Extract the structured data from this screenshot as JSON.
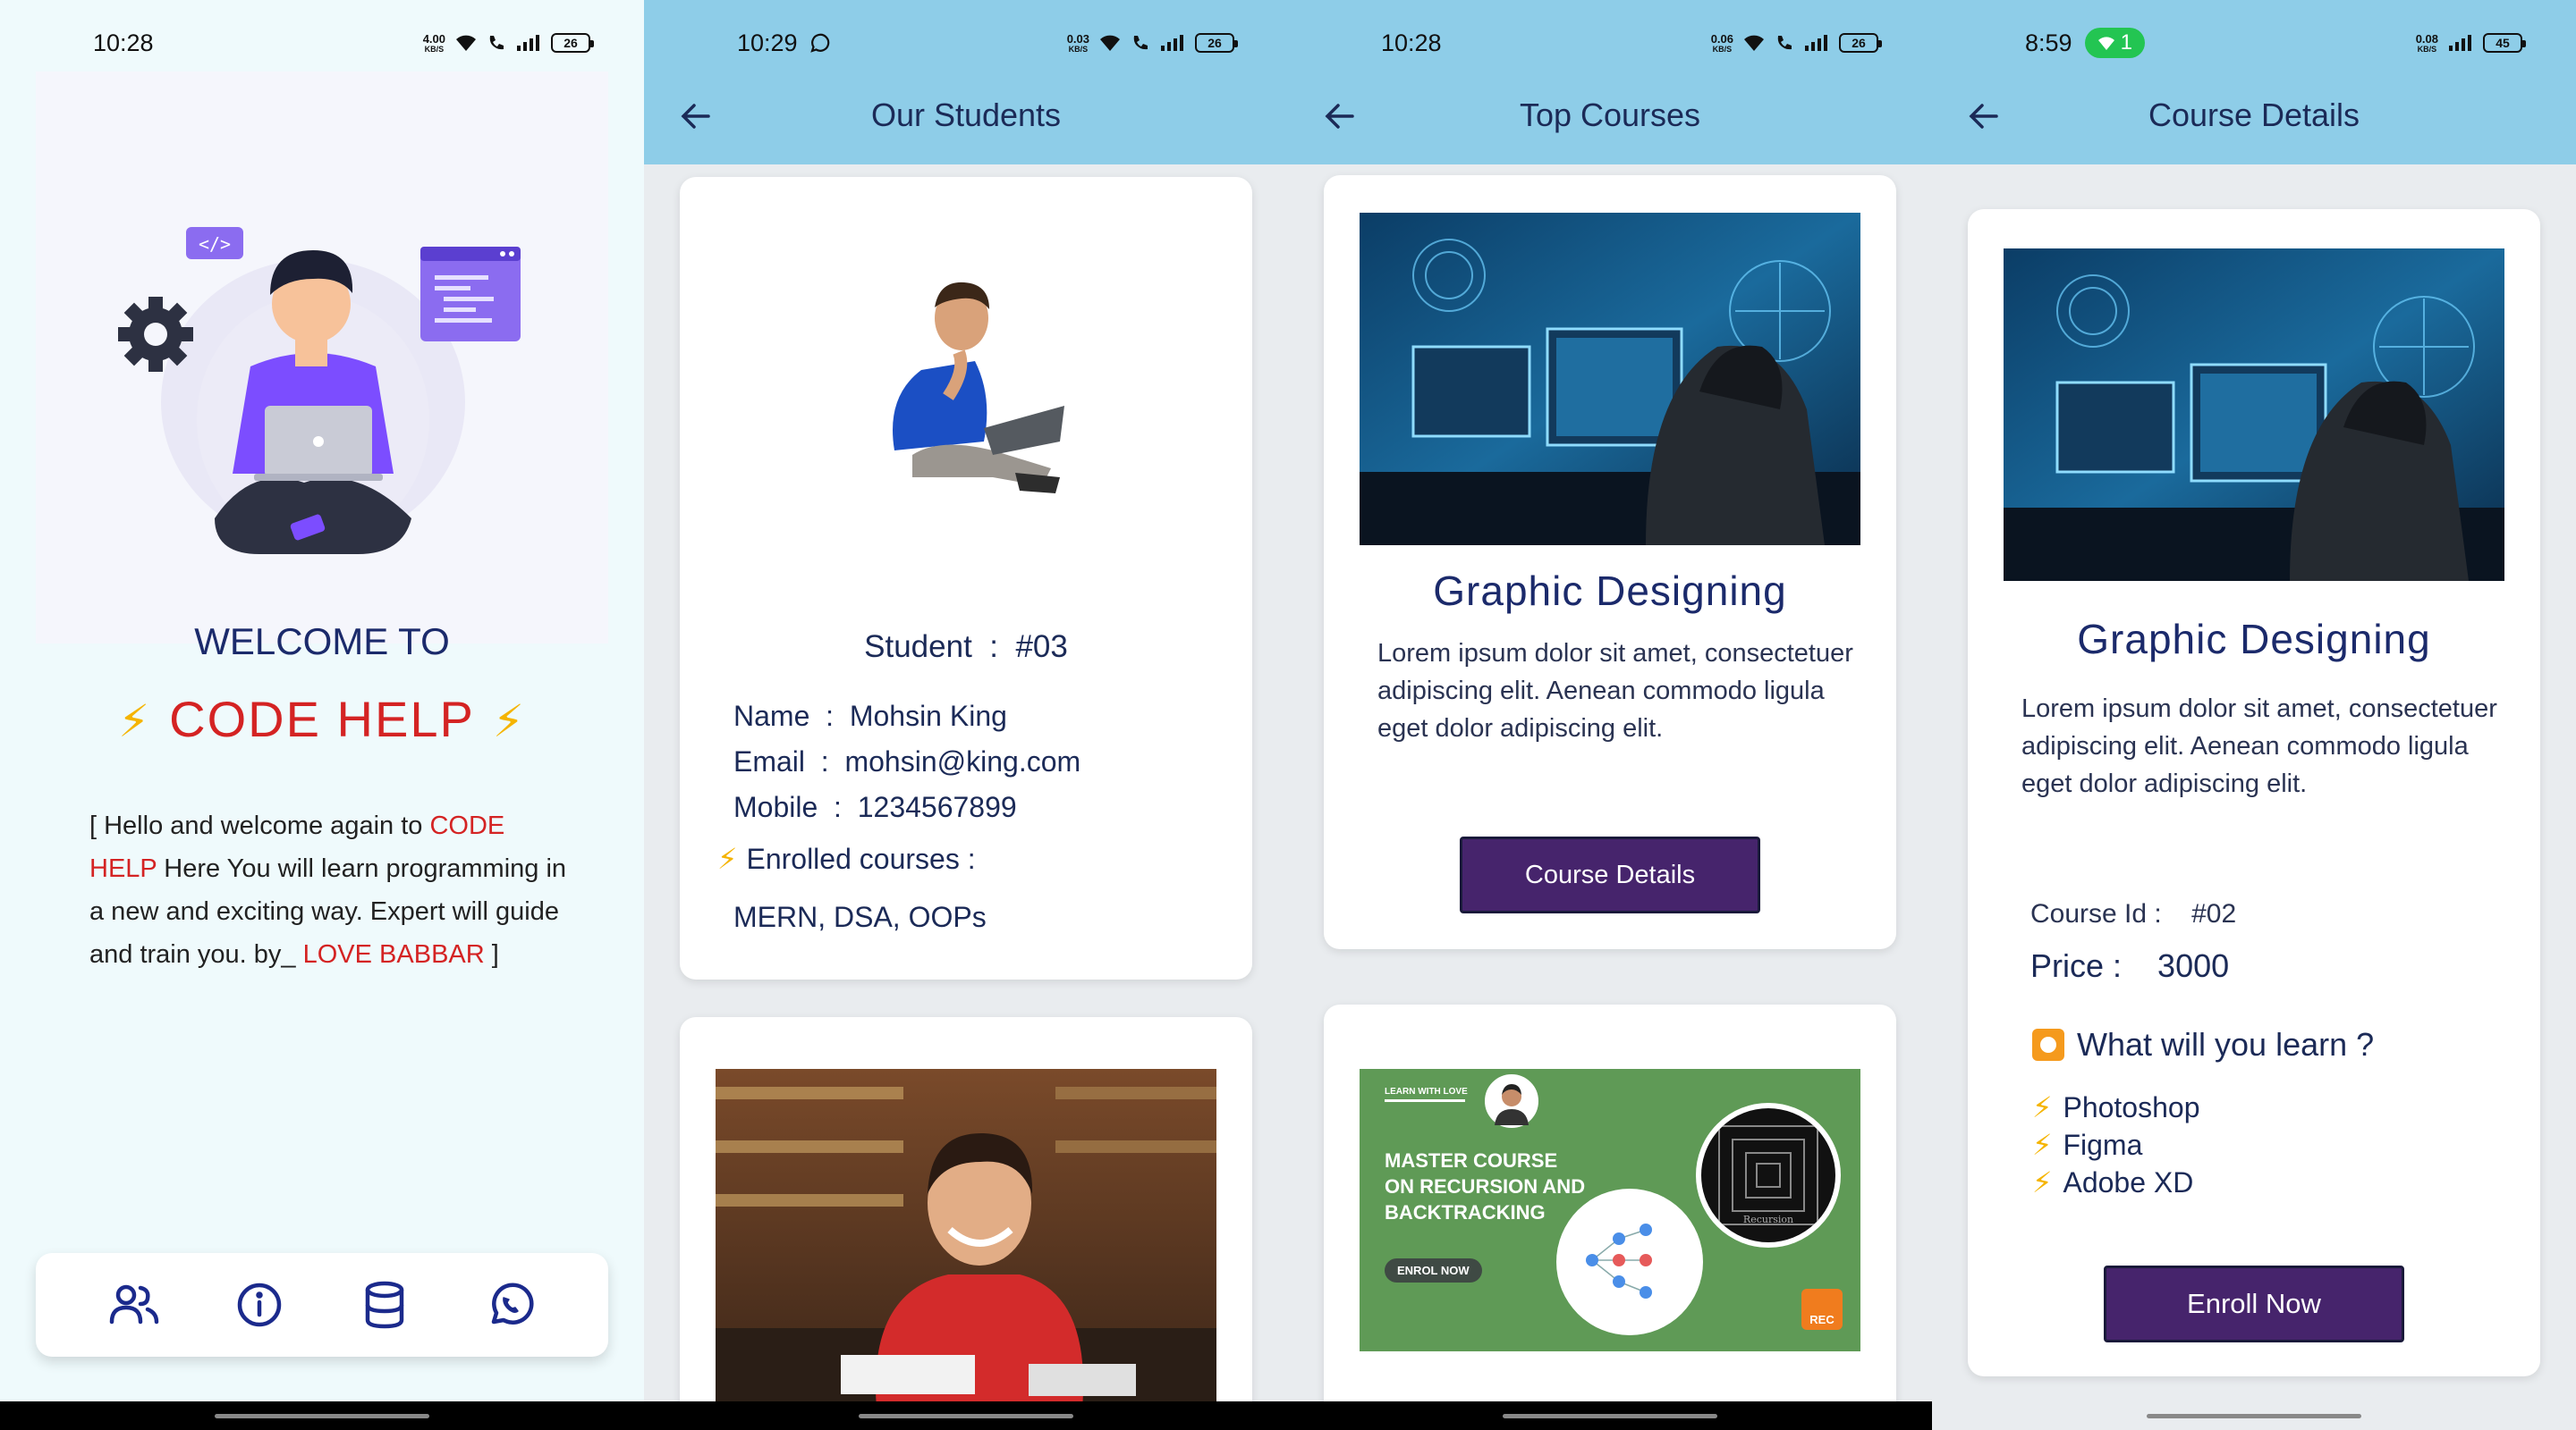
{
  "screen1": {
    "status": {
      "time": "10:28",
      "speed": "4.00",
      "speed_unit": "KB/S",
      "battery": "26"
    },
    "welcome": "WELCOME TO",
    "brand": "CODE HELP",
    "intro": {
      "p1": "[ Hello and welcome again to ",
      "red1": "CODE HELP",
      "p2": "  Here You will learn programming in a new and exciting way. Expert will guide and train you. by_ ",
      "red2": "LOVE BABBAR",
      "p3": "  ]"
    },
    "nav": [
      "students-icon",
      "info-icon",
      "database-icon",
      "whatsapp-icon"
    ]
  },
  "screen2": {
    "status": {
      "time": "10:29",
      "speed": "0.03",
      "speed_unit": "KB/S",
      "battery": "26"
    },
    "title": "Our Students",
    "student": {
      "label": "Student",
      "sep": ":",
      "id": "#03",
      "name_label": "Name",
      "name": "Mohsin King",
      "email_label": "Email",
      "email": "mohsin@king.com",
      "mobile_label": "Mobile",
      "mobile": "1234567899",
      "enrolled_label": "Enrolled courses :",
      "courses": "MERN, DSA, OOPs"
    }
  },
  "screen3": {
    "status": {
      "time": "10:28",
      "speed": "0.06",
      "speed_unit": "KB/S",
      "battery": "26"
    },
    "title": "Top Courses",
    "course": {
      "title": "Graphic Designing",
      "desc": "Lorem ipsum dolor sit amet, consectetuer adipiscing elit. Aenean commodo ligula eget dolor adipiscing elit.",
      "button": "Course Details"
    },
    "banner": {
      "tag": "LEARN WITH LOVE",
      "headline1": "MASTER COURSE",
      "headline2": "ON RECURSION AND",
      "headline3": "BACKTRACKING",
      "cta": "ENROL NOW",
      "rec": "REC",
      "ring": "Recursion"
    }
  },
  "screen4": {
    "status": {
      "time": "8:59",
      "hotspot": "1",
      "speed": "0.08",
      "speed_unit": "KB/S",
      "battery": "45"
    },
    "title": "Course Details",
    "course": {
      "title": "Graphic Designing",
      "desc": "Lorem ipsum dolor sit amet, consectetuer adipiscing elit. Aenean commodo ligula eget dolor adipiscing elit.",
      "id_label": "Course Id :",
      "id": "#02",
      "price_label": "Price :",
      "price": "3000",
      "learn_head": "What will you learn ?",
      "learn": [
        "Photoshop",
        "Figma",
        "Adobe XD"
      ],
      "button": "Enroll Now"
    }
  },
  "colors": {
    "appbar": "#8ecde8",
    "accent_red": "#d42323",
    "button": "#46246c",
    "navy": "#1b2a6b",
    "bolt": "#f5b400"
  }
}
